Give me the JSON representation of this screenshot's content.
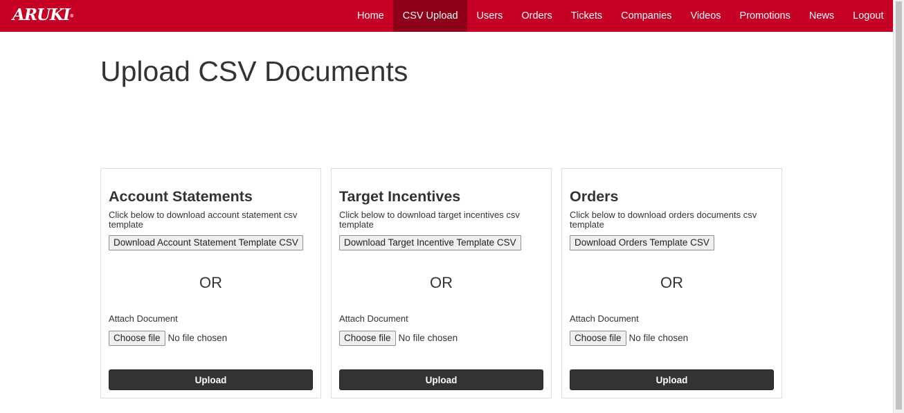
{
  "brand": {
    "logo_text": "ARUKI",
    "logo_mark": "®"
  },
  "nav": {
    "active_color": "#8e0018",
    "bar_color": "#c50024",
    "items": [
      {
        "label": "Home",
        "active": false
      },
      {
        "label": "CSV Upload",
        "active": true
      },
      {
        "label": "Users",
        "active": false
      },
      {
        "label": "Orders",
        "active": false
      },
      {
        "label": "Tickets",
        "active": false
      },
      {
        "label": "Companies",
        "active": false
      },
      {
        "label": "Videos",
        "active": false
      },
      {
        "label": "Promotions",
        "active": false
      },
      {
        "label": "News",
        "active": false
      },
      {
        "label": "Logout",
        "active": false
      }
    ]
  },
  "page": {
    "title": "Upload CSV Documents"
  },
  "cards": [
    {
      "title": "Account Statements",
      "description": "Click below to download account statement csv template",
      "download_label": "Download Account Statement Template CSV",
      "or_label": "OR",
      "attach_label": "Attach Document",
      "choose_label": "Choose file",
      "file_status": "No file chosen",
      "upload_label": "Upload"
    },
    {
      "title": "Target Incentives",
      "description": "Click below to download target incentives csv template",
      "download_label": "Download Target Incentive Template CSV",
      "or_label": "OR",
      "attach_label": "Attach Document",
      "choose_label": "Choose file",
      "file_status": "No file chosen",
      "upload_label": "Upload"
    },
    {
      "title": "Orders",
      "description": "Click below to download orders documents csv template",
      "download_label": "Download Orders Template CSV",
      "or_label": "OR",
      "attach_label": "Attach Document",
      "choose_label": "Choose file",
      "file_status": "No file chosen",
      "upload_label": "Upload"
    }
  ]
}
